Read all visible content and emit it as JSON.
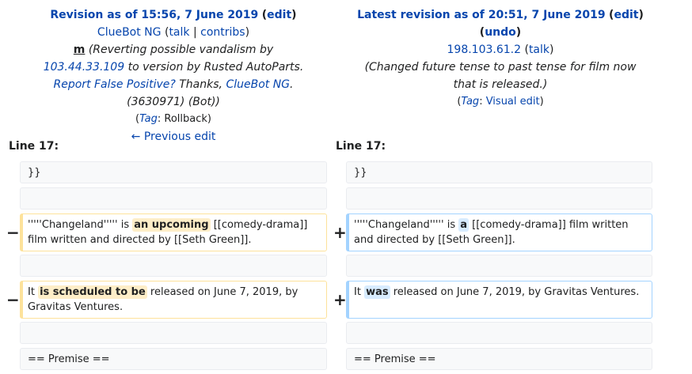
{
  "left_header": {
    "title": "Revision as of 15:56, 7 June 2019",
    "edit": "edit",
    "user": "ClueBot NG",
    "talk": "talk",
    "contribs": "contribs",
    "minor_mark": "m",
    "summary_pre": "(Reverting possible vandalism by ",
    "vandal_ip": "103.44.33.109",
    "summary_mid": " to version by Rusted AutoParts. ",
    "report_link": "Report False Positive?",
    "summary_thanks": "Thanks, ",
    "thanks_user": "ClueBot NG",
    "summary_post": ". (3630971) (Bot))",
    "tag_label": "Tag",
    "tag_value": "Rollback",
    "prev_edit": "← Previous edit"
  },
  "right_header": {
    "title": "Latest revision as of 20:51, 7 June 2019",
    "edit": "edit",
    "undo": "undo",
    "user_ip": "198.103.61.2",
    "talk": "talk",
    "summary": "(Changed future tense to past tense for film now that is released.)",
    "tag_label": "Tag",
    "tag_value": "Visual edit"
  },
  "diff": {
    "line_label_left": "Line 17:",
    "line_label_right": "Line 17:",
    "minus": "−",
    "plus": "+",
    "ctx1": "}}",
    "ctx_premise": "== Premise ==",
    "del1_pre": "'''''Changeland''''' is ",
    "del1_hl": "an upcoming",
    "del1_post": " [[comedy-drama]] film written and directed by [[Seth Green]].",
    "add1_pre": "'''''Changeland''''' is ",
    "add1_hl": "a",
    "add1_post": " [[comedy-drama]] film written and directed by [[Seth Green]].",
    "del2_pre": "It ",
    "del2_hl": "is scheduled to be",
    "del2_post": " released on June 7, 2019, by Gravitas Ventures.",
    "add2_pre": "It ",
    "add2_hl": "was",
    "add2_post": " released on June 7, 2019, by Gravitas Ventures."
  }
}
